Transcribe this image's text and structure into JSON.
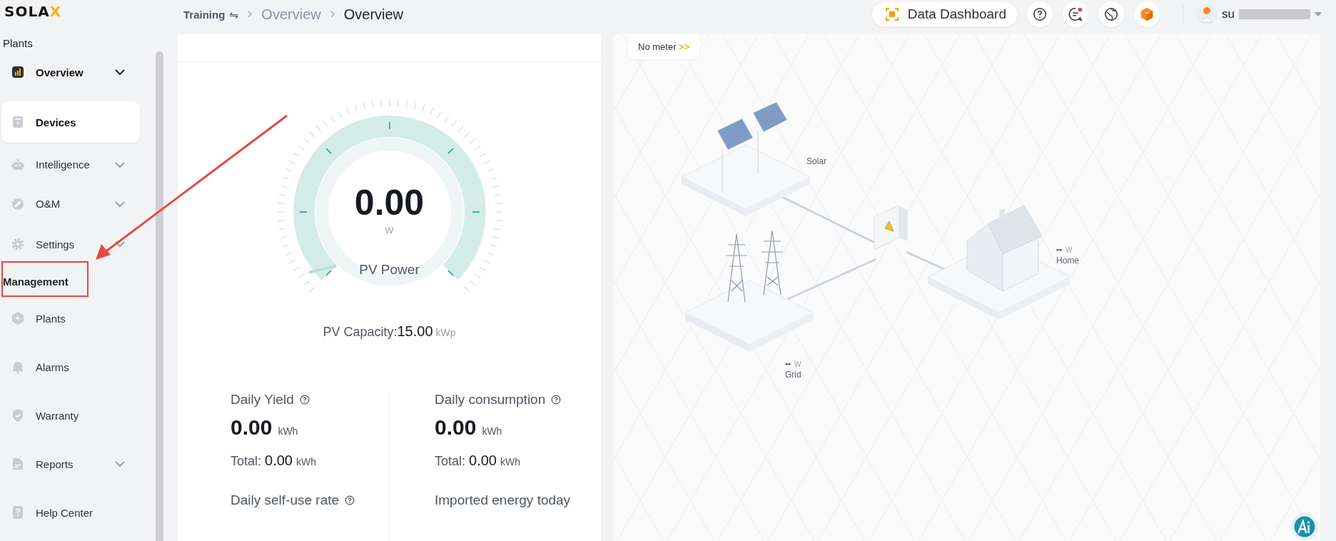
{
  "logo": {
    "text": "SOLA",
    "accent": "X"
  },
  "sidebar": {
    "sections": [
      {
        "title": "Plants",
        "items": [
          {
            "label": "Overview",
            "active": true,
            "selected": false,
            "submenu": true
          },
          {
            "label": "Devices",
            "active": true,
            "selected": true,
            "submenu": false
          },
          {
            "label": "Intelligence",
            "active": false,
            "selected": false,
            "submenu": true
          },
          {
            "label": "O&M",
            "active": false,
            "selected": false,
            "submenu": true
          },
          {
            "label": "Settings",
            "active": false,
            "selected": false,
            "submenu": true
          }
        ]
      },
      {
        "title": "Management",
        "items": [
          {
            "label": "Plants",
            "active": false,
            "selected": false,
            "submenu": false
          },
          {
            "label": "Alarms",
            "active": false,
            "selected": false,
            "submenu": false
          },
          {
            "label": "Warranty",
            "active": false,
            "selected": false,
            "submenu": false
          },
          {
            "label": "Reports",
            "active": false,
            "selected": false,
            "submenu": true
          },
          {
            "label": "Help Center",
            "active": false,
            "selected": false,
            "submenu": false
          }
        ]
      }
    ]
  },
  "breadcrumb": {
    "station": "Training",
    "switch_icon": "⇋",
    "items": [
      "Overview",
      "Overview"
    ]
  },
  "header": {
    "dashboard_button": "Data Dashboard",
    "user": "su",
    "icons": [
      {
        "kind": "help",
        "badge": false
      },
      {
        "kind": "message",
        "badge": true
      },
      {
        "kind": "globe",
        "badge": false
      },
      {
        "kind": "cube",
        "badge": false
      }
    ]
  },
  "gauge": {
    "value": "0.00",
    "unit": "W",
    "label": "PV Power",
    "level": 0,
    "capacity_label": "PV Capacity:",
    "capacity_value": "15.00",
    "capacity_unit": "kWp"
  },
  "stats": [
    {
      "label": "Daily Yield",
      "help": true,
      "value": "0.00",
      "unit": "kWh",
      "total_label": "Total:",
      "total_value": "0.00",
      "total_unit": "kWh"
    },
    {
      "label": "Daily consumption",
      "help": true,
      "value": "0.00",
      "unit": "kWh",
      "total_label": "Total:",
      "total_value": "0.00",
      "total_unit": "kWh"
    },
    {
      "label": "Daily self-use rate",
      "help": true
    },
    {
      "label": "Imported energy today",
      "help": false
    }
  ],
  "flow": {
    "meter_chip": "No meter",
    "meter_chevron": ">>",
    "nodes": [
      {
        "kind": "solar",
        "label": "Solar"
      },
      {
        "kind": "grid",
        "value": "--",
        "unit": "W",
        "label": "Grid"
      },
      {
        "kind": "home",
        "value": "--",
        "unit": "W",
        "label": "Home"
      }
    ]
  },
  "annotation": {
    "highlight": true
  }
}
